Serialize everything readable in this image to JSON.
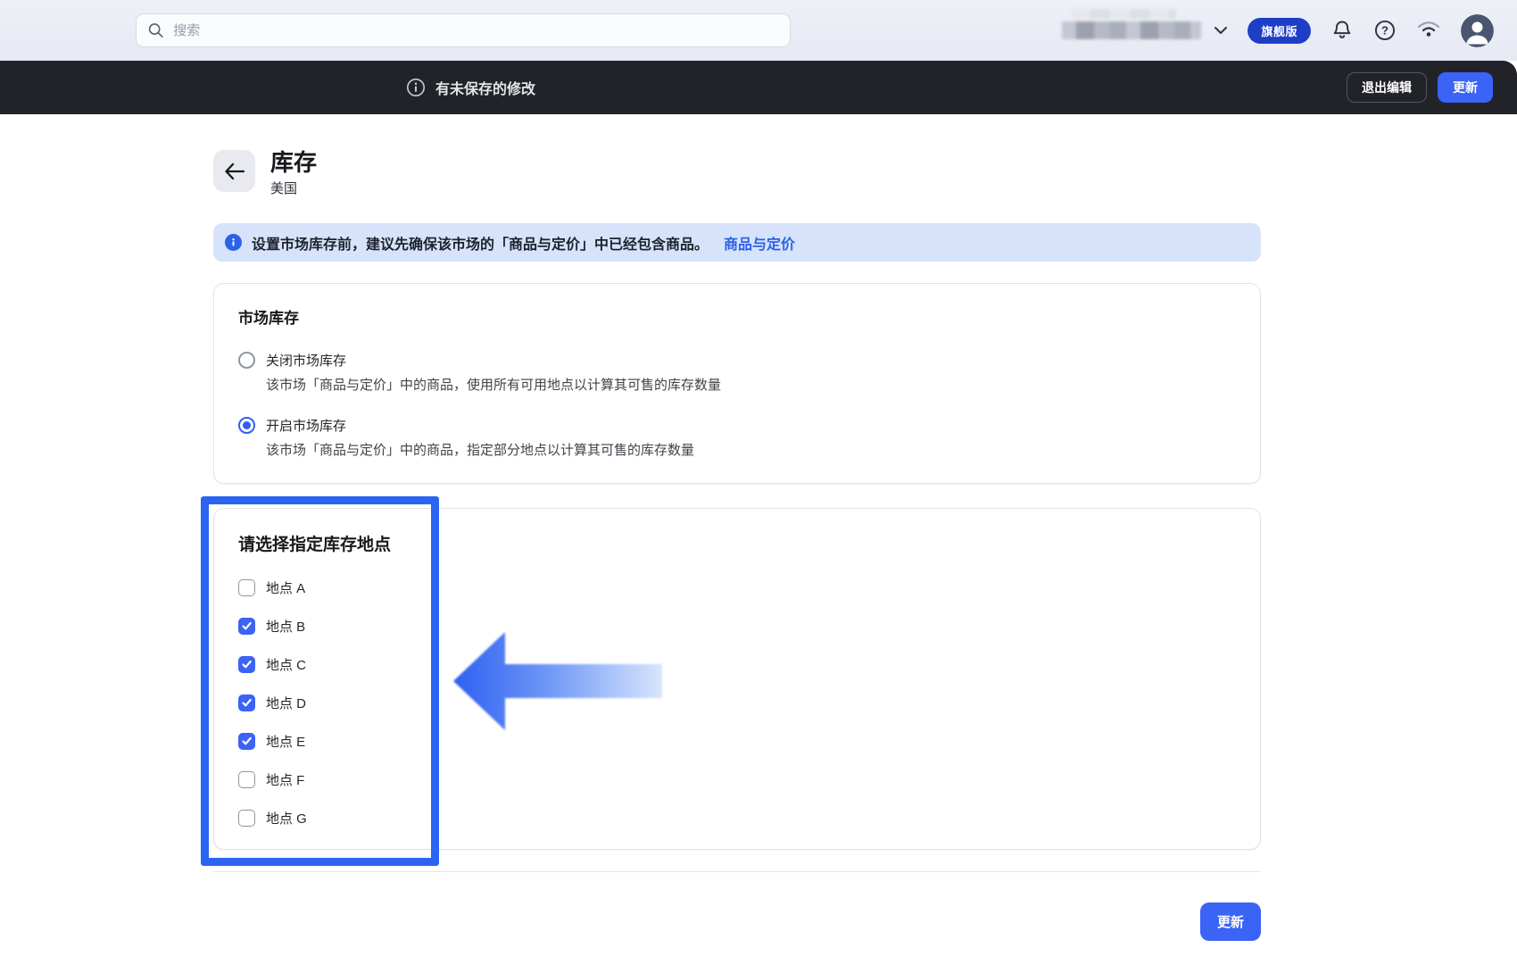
{
  "topbar": {
    "search_placeholder": "搜索",
    "plan_badge": "旗舰版",
    "icons": [
      "search-icon",
      "chevron-down-icon",
      "bell-icon",
      "help-icon",
      "wifi-icon",
      "avatar"
    ]
  },
  "save_bar": {
    "message": "有未保存的修改",
    "discard_label": "退出编辑",
    "save_label": "更新"
  },
  "page": {
    "title": "库存",
    "subtitle": "美国"
  },
  "banner": {
    "text": "设置市场库存前，建议先确保该市场的「商品与定价」中已经包含商品。",
    "link_label": "商品与定价"
  },
  "market_inventory_card": {
    "title": "市场库存",
    "options": [
      {
        "label": "关闭市场库存",
        "description": "该市场「商品与定价」中的商品，使用所有可用地点以计算其可售的库存数量",
        "selected": false
      },
      {
        "label": "开启市场库存",
        "description": "该市场「商品与定价」中的商品，指定部分地点以计算其可售的库存数量",
        "selected": true
      }
    ]
  },
  "locations_card": {
    "title": "请选择指定库存地点",
    "items": [
      {
        "label": "地点 A",
        "checked": false
      },
      {
        "label": "地点 B",
        "checked": true
      },
      {
        "label": "地点 C",
        "checked": true
      },
      {
        "label": "地点 D",
        "checked": true
      },
      {
        "label": "地点 E",
        "checked": true
      },
      {
        "label": "地点 F",
        "checked": false
      },
      {
        "label": "地点 G",
        "checked": false
      }
    ]
  },
  "footer": {
    "update_label": "更新"
  },
  "colors": {
    "accent_blue": "#3b63f5",
    "badge_blue": "#1d3fc7",
    "annotation_blue": "#2b63f2",
    "link_blue": "#2a62e8",
    "banner_bg": "#d7e3fb",
    "save_bar_bg": "#212329"
  }
}
